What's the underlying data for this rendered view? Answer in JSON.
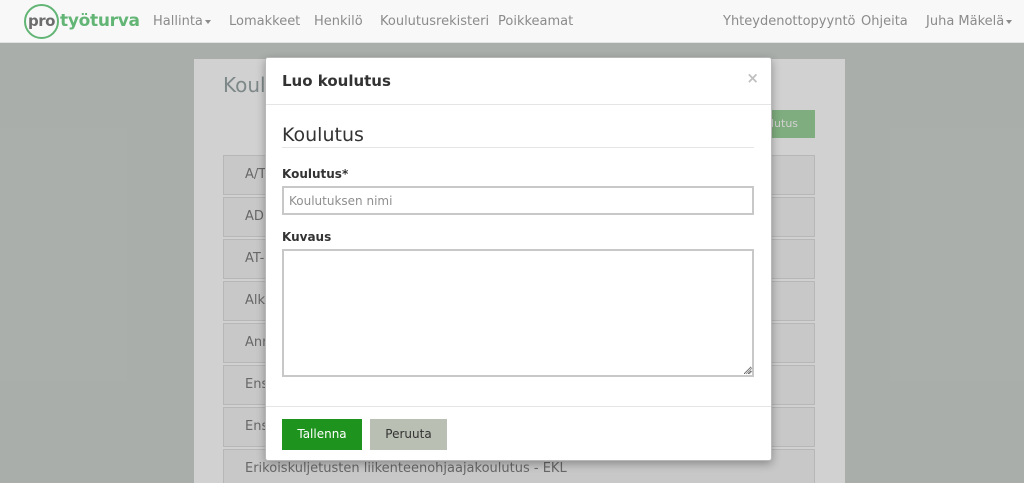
{
  "navbar": {
    "logo_pro": "pro",
    "logo_name": "työturva",
    "items": [
      "Hallinta",
      "Lomakkeet",
      "Henkilö",
      "Koulutusrekisteri",
      "Poikkeamat"
    ],
    "right_items": [
      "Yhteydenottopyyntö",
      "Ohjeita",
      "Juha Mäkelä"
    ]
  },
  "background": {
    "title": "Koul",
    "add_button": "ulutus",
    "rows": [
      "A/T-",
      "ADR",
      "AT-p",
      "Alku",
      "Ann",
      "Ensi",
      "Ensi",
      "Erikoiskuljetusten liikenteenohjaajakoulutus - EKL"
    ]
  },
  "modal": {
    "title": "Luo koulutus",
    "close": "×",
    "section_title": "Koulutus",
    "name_label": "Koulutus*",
    "name_placeholder": "Koulutuksen nimi",
    "name_value": "",
    "desc_label": "Kuvaus",
    "desc_value": "",
    "save_label": "Tallenna",
    "cancel_label": "Peruuta"
  },
  "colors": {
    "brand": "#62b575",
    "save_button": "#1e931e",
    "cancel_button": "#b9bfb3"
  }
}
